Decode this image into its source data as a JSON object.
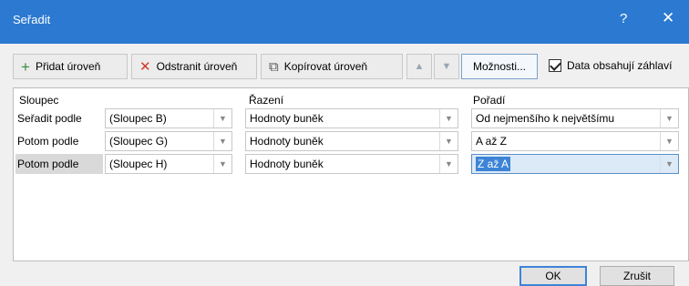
{
  "window": {
    "title": "Seřadit",
    "help_glyph": "?",
    "close_glyph": "✕"
  },
  "toolbar": {
    "add_level": "Přidat úroveň",
    "delete_level": "Odstranit úroveň",
    "copy_level": "Kopírovat úroveň",
    "move_up_glyph": "▲",
    "move_down_glyph": "▼",
    "options": "Možnosti...",
    "has_headers_label": "Data obsahují záhlaví",
    "has_headers_checked": true
  },
  "grid": {
    "headers": {
      "column": "Sloupec",
      "sort_on": "Řazení",
      "order": "Pořadí"
    },
    "rows": [
      {
        "label": "Seřadit podle",
        "column": "(Sloupec B)",
        "sort_on": "Hodnoty buněk",
        "order": "Od nejmenšího k největšímu"
      },
      {
        "label": "Potom podle",
        "column": "(Sloupec G)",
        "sort_on": "Hodnoty buněk",
        "order": "A až Z"
      },
      {
        "label": "Potom podle",
        "column": "(Sloupec H)",
        "sort_on": "Hodnoty buněk",
        "order": "Z až A"
      }
    ],
    "selected_row": 2
  },
  "footer": {
    "ok": "OK",
    "cancel": "Zrušit"
  },
  "colors": {
    "titlebar": "#2b79d0",
    "selection": "#3d84d6"
  },
  "icons": [
    "plus-icon",
    "delete-x-icon",
    "copy-icon",
    "chevron-down-icon",
    "checkmark-icon"
  ]
}
